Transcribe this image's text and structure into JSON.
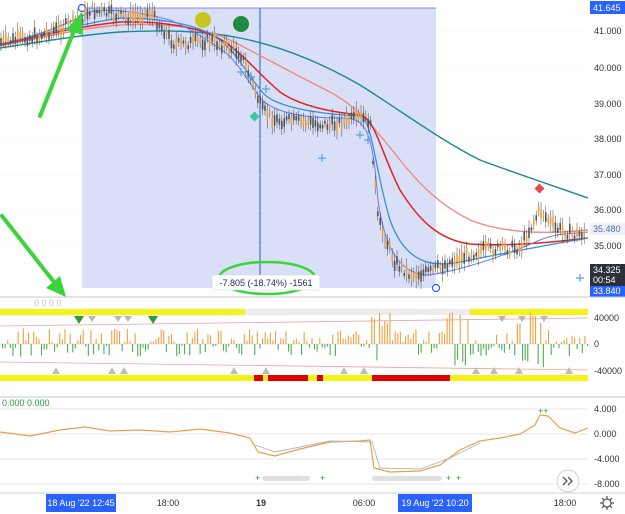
{
  "colors": {
    "accent": "#2962ff",
    "selection_fill": "#d6dcf7",
    "annotation_green": "#3cd43c",
    "ema_teal": "#1a8a96",
    "ema_red": "#e02424",
    "ema_salmon": "#ee8a80",
    "ema_blue": "#3a8fd8",
    "price_close_tag": "#2a2f3a",
    "osc_orange": "#e8a050",
    "bar_yellow": "#f5f215",
    "bar_red": "#e00000",
    "bar_grey": "#c8c8c8"
  },
  "price_axis": {
    "labels": [
      "41.000",
      "40.000",
      "39.000",
      "38.000",
      "37.000",
      "36.000",
      "35.000"
    ],
    "tags": {
      "top": "41.645",
      "blue": "35.480",
      "last_price": "34.325",
      "countdown": "00:54",
      "low": "33.840"
    }
  },
  "measure_label": "-7.805 (-18.74%) -1561",
  "volume_axis": {
    "labels": [
      "40000",
      "0",
      "-40000"
    ]
  },
  "volume_legend": "0 0 0 0",
  "osc_axis": {
    "labels": [
      "4.000",
      "0.000",
      "-4.000",
      "-8.000"
    ]
  },
  "osc_legend": "0.000  0.000",
  "time_axis": {
    "labels": [
      "18:00",
      "19",
      "06:00",
      "18:00"
    ],
    "range_start": "18 Aug '22  12:45",
    "range_end": "19 Aug '22  10:20"
  },
  "icons": {
    "scroll_right": "chevron-double-right-icon",
    "settings": "gear-icon"
  }
}
